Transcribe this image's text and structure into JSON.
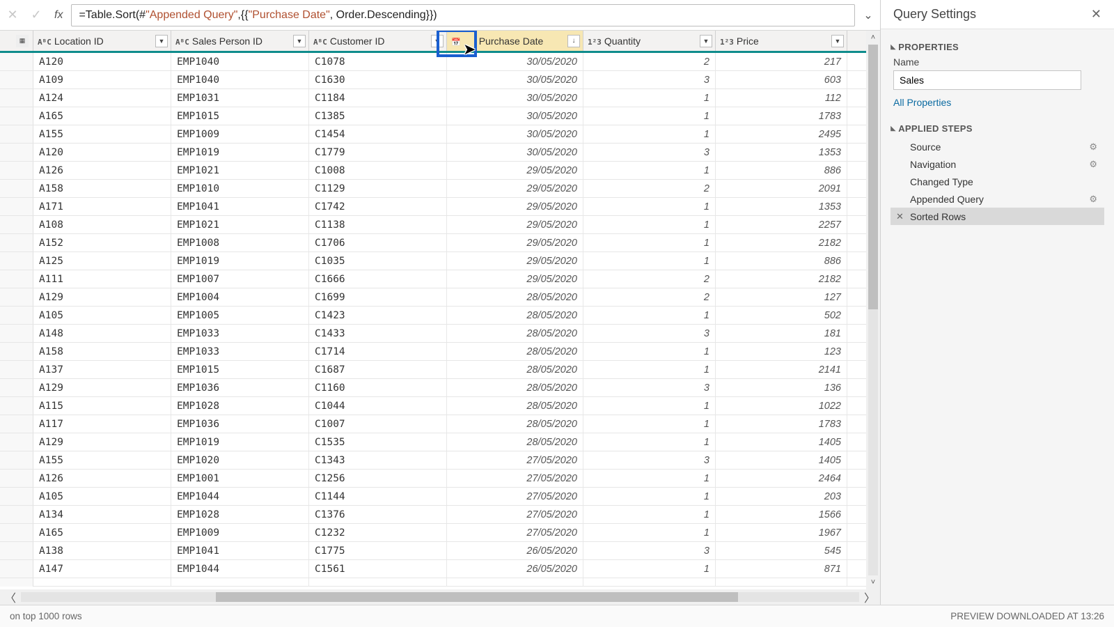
{
  "formula": {
    "prefix": "= ",
    "fn1": "Table.Sort",
    "open": "(#",
    "str1": "\"Appended Query\"",
    "mid": ",{{",
    "str2": "\"Purchase Date\"",
    "tail": ", Order.Descending}})"
  },
  "columns": {
    "location": "Location ID",
    "sales_person": "Sales Person ID",
    "customer": "Customer ID",
    "purchase_date": "Purchase Date",
    "quantity": "Quantity",
    "price": "Price"
  },
  "type_icons": {
    "abc": "AᴮC",
    "num": "1²3",
    "cal": "📅"
  },
  "rows": [
    {
      "loc": "A120",
      "sp": "EMP1040",
      "cu": "C1078",
      "dt": "30/05/2020",
      "qt": "2",
      "pr": "217"
    },
    {
      "loc": "A109",
      "sp": "EMP1040",
      "cu": "C1630",
      "dt": "30/05/2020",
      "qt": "3",
      "pr": "603"
    },
    {
      "loc": "A124",
      "sp": "EMP1031",
      "cu": "C1184",
      "dt": "30/05/2020",
      "qt": "1",
      "pr": "112"
    },
    {
      "loc": "A165",
      "sp": "EMP1015",
      "cu": "C1385",
      "dt": "30/05/2020",
      "qt": "1",
      "pr": "1783"
    },
    {
      "loc": "A155",
      "sp": "EMP1009",
      "cu": "C1454",
      "dt": "30/05/2020",
      "qt": "1",
      "pr": "2495"
    },
    {
      "loc": "A120",
      "sp": "EMP1019",
      "cu": "C1779",
      "dt": "30/05/2020",
      "qt": "3",
      "pr": "1353"
    },
    {
      "loc": "A126",
      "sp": "EMP1021",
      "cu": "C1008",
      "dt": "29/05/2020",
      "qt": "1",
      "pr": "886"
    },
    {
      "loc": "A158",
      "sp": "EMP1010",
      "cu": "C1129",
      "dt": "29/05/2020",
      "qt": "2",
      "pr": "2091"
    },
    {
      "loc": "A171",
      "sp": "EMP1041",
      "cu": "C1742",
      "dt": "29/05/2020",
      "qt": "1",
      "pr": "1353"
    },
    {
      "loc": "A108",
      "sp": "EMP1021",
      "cu": "C1138",
      "dt": "29/05/2020",
      "qt": "1",
      "pr": "2257"
    },
    {
      "loc": "A152",
      "sp": "EMP1008",
      "cu": "C1706",
      "dt": "29/05/2020",
      "qt": "1",
      "pr": "2182"
    },
    {
      "loc": "A125",
      "sp": "EMP1019",
      "cu": "C1035",
      "dt": "29/05/2020",
      "qt": "1",
      "pr": "886"
    },
    {
      "loc": "A111",
      "sp": "EMP1007",
      "cu": "C1666",
      "dt": "29/05/2020",
      "qt": "2",
      "pr": "2182"
    },
    {
      "loc": "A129",
      "sp": "EMP1004",
      "cu": "C1699",
      "dt": "28/05/2020",
      "qt": "2",
      "pr": "127"
    },
    {
      "loc": "A105",
      "sp": "EMP1005",
      "cu": "C1423",
      "dt": "28/05/2020",
      "qt": "1",
      "pr": "502"
    },
    {
      "loc": "A148",
      "sp": "EMP1033",
      "cu": "C1433",
      "dt": "28/05/2020",
      "qt": "3",
      "pr": "181"
    },
    {
      "loc": "A158",
      "sp": "EMP1033",
      "cu": "C1714",
      "dt": "28/05/2020",
      "qt": "1",
      "pr": "123"
    },
    {
      "loc": "A137",
      "sp": "EMP1015",
      "cu": "C1687",
      "dt": "28/05/2020",
      "qt": "1",
      "pr": "2141"
    },
    {
      "loc": "A129",
      "sp": "EMP1036",
      "cu": "C1160",
      "dt": "28/05/2020",
      "qt": "3",
      "pr": "136"
    },
    {
      "loc": "A115",
      "sp": "EMP1028",
      "cu": "C1044",
      "dt": "28/05/2020",
      "qt": "1",
      "pr": "1022"
    },
    {
      "loc": "A117",
      "sp": "EMP1036",
      "cu": "C1007",
      "dt": "28/05/2020",
      "qt": "1",
      "pr": "1783"
    },
    {
      "loc": "A129",
      "sp": "EMP1019",
      "cu": "C1535",
      "dt": "28/05/2020",
      "qt": "1",
      "pr": "1405"
    },
    {
      "loc": "A155",
      "sp": "EMP1020",
      "cu": "C1343",
      "dt": "27/05/2020",
      "qt": "3",
      "pr": "1405"
    },
    {
      "loc": "A126",
      "sp": "EMP1001",
      "cu": "C1256",
      "dt": "27/05/2020",
      "qt": "1",
      "pr": "2464"
    },
    {
      "loc": "A105",
      "sp": "EMP1044",
      "cu": "C1144",
      "dt": "27/05/2020",
      "qt": "1",
      "pr": "203"
    },
    {
      "loc": "A134",
      "sp": "EMP1028",
      "cu": "C1376",
      "dt": "27/05/2020",
      "qt": "1",
      "pr": "1566"
    },
    {
      "loc": "A165",
      "sp": "EMP1009",
      "cu": "C1232",
      "dt": "27/05/2020",
      "qt": "1",
      "pr": "1967"
    },
    {
      "loc": "A138",
      "sp": "EMP1041",
      "cu": "C1775",
      "dt": "26/05/2020",
      "qt": "3",
      "pr": "545"
    },
    {
      "loc": "A147",
      "sp": "EMP1044",
      "cu": "C1561",
      "dt": "26/05/2020",
      "qt": "1",
      "pr": "871"
    }
  ],
  "query_settings": {
    "title": "Query Settings",
    "properties_hdr": "PROPERTIES",
    "name_label": "Name",
    "name_value": "Sales",
    "all_props": "All Properties",
    "applied_hdr": "APPLIED STEPS",
    "steps": [
      {
        "label": "Source",
        "gear": true
      },
      {
        "label": "Navigation",
        "gear": true
      },
      {
        "label": "Changed Type",
        "gear": false
      },
      {
        "label": "Appended Query",
        "gear": true
      },
      {
        "label": "Sorted Rows",
        "gear": false,
        "selected": true,
        "del": true
      }
    ]
  },
  "status": {
    "left": "on top 1000 rows",
    "right": "PREVIEW DOWNLOADED AT 13:26"
  }
}
